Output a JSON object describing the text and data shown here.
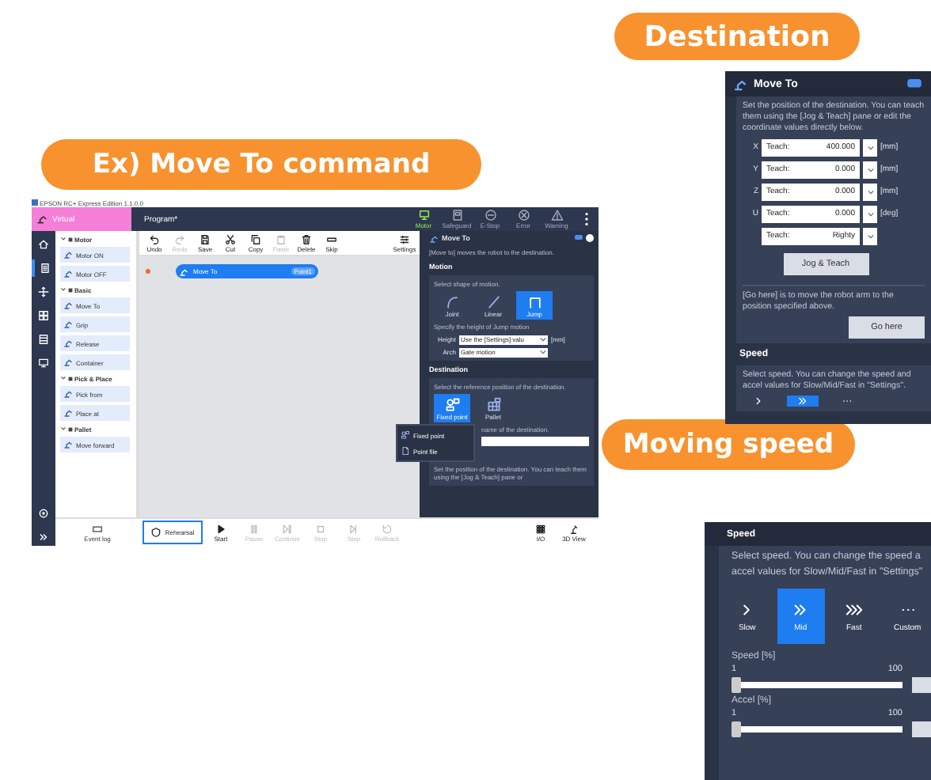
{
  "main_screenshot": {
    "callout": "Ex) Move To command",
    "window_title": "EPSON RC+ Express Edition 1.1.0.0",
    "mode_tab": "Virtual",
    "document_title": "Program*",
    "status_items": [
      {
        "label": "Motor",
        "kind": "motor",
        "on": true
      },
      {
        "label": "Safeguard",
        "kind": "safeguard",
        "on": false
      },
      {
        "label": "E-Stop",
        "kind": "estop",
        "on": false
      },
      {
        "label": "Error",
        "kind": "error",
        "on": false
      },
      {
        "label": "Warning",
        "kind": "warning",
        "on": false
      }
    ],
    "rail_items": [
      {
        "kind": "home",
        "selected": false
      },
      {
        "kind": "program",
        "selected": true
      },
      {
        "kind": "move",
        "selected": false
      },
      {
        "kind": "grid",
        "selected": false
      },
      {
        "kind": "table",
        "selected": false
      },
      {
        "kind": "monitor",
        "selected": false
      }
    ],
    "palette": [
      {
        "label": "Motor",
        "expanded": true,
        "items": [
          {
            "label": "Motor ON"
          },
          {
            "label": "Motor OFF"
          }
        ]
      },
      {
        "label": "Basic",
        "expanded": true,
        "items": [
          {
            "label": "Move To"
          },
          {
            "label": "Grip"
          },
          {
            "label": "Release"
          },
          {
            "label": "Container"
          }
        ]
      },
      {
        "label": "Pick & Place",
        "expanded": true,
        "items": [
          {
            "label": "Pick from"
          },
          {
            "label": "Place at"
          }
        ]
      },
      {
        "label": "Pallet",
        "expanded": true,
        "items": [
          {
            "label": "Move forward"
          }
        ]
      }
    ],
    "event_log": "Event log",
    "toolbar": [
      {
        "label": "Undo",
        "kind": "undo",
        "disabled": false
      },
      {
        "label": "Redo",
        "kind": "redo",
        "disabled": true
      },
      {
        "label": "Save",
        "kind": "save",
        "disabled": false
      },
      {
        "label": "Cut",
        "kind": "cut",
        "disabled": false
      },
      {
        "label": "Copy",
        "kind": "copy",
        "disabled": false
      },
      {
        "label": "Paste",
        "kind": "paste",
        "disabled": true
      },
      {
        "label": "Delete",
        "kind": "delete",
        "disabled": false
      },
      {
        "label": "Skip",
        "kind": "skip",
        "disabled": false
      }
    ],
    "settings_button": "Settings",
    "flow_node": {
      "label": "Move To",
      "badge": "Point1",
      "selected": true
    },
    "properties": {
      "title": "Move To",
      "description": "[Move to] moves the robot to the destination.",
      "motion": {
        "heading": "Motion",
        "prompt": "Select shape of motion.",
        "options": [
          {
            "label": "Joint",
            "kind": "joint",
            "selected": false
          },
          {
            "label": "Linear",
            "kind": "linear",
            "selected": false
          },
          {
            "label": "Jump",
            "kind": "jump",
            "selected": true
          }
        ],
        "height_prompt": "Specify the height of Jump motion",
        "height_label": "Height",
        "height_value": "Use the [Settings] valu",
        "height_unit": "[mm]",
        "arch_label": "Arch",
        "arch_value": "Gate motion"
      },
      "destination": {
        "heading": "Destination",
        "prompt": "Select the reference position of the destination.",
        "options": [
          {
            "label": "Fixed point",
            "kind": "fixed",
            "selected": true
          },
          {
            "label": "Pallet",
            "kind": "pallet",
            "selected": false
          }
        ],
        "menu": [
          {
            "label": "Fixed point",
            "kind": "fixed"
          },
          {
            "label": "Point file",
            "kind": "file"
          }
        ],
        "name_prompt": "name of the destination.",
        "position_prompt": "Set the position of the destination. You can teach them using the [Jog & Teach] pane or"
      }
    },
    "run_controls": [
      {
        "label": "Rehearsal",
        "kind": "rehearsal",
        "disabled": false,
        "selected": true
      },
      {
        "label": "Start",
        "kind": "start",
        "disabled": false,
        "selected": false
      },
      {
        "label": "Pause",
        "kind": "pause",
        "disabled": true,
        "selected": false
      },
      {
        "label": "Continue",
        "kind": "continue",
        "disabled": true,
        "selected": false
      },
      {
        "label": "Stop",
        "kind": "stop",
        "disabled": true,
        "selected": false
      },
      {
        "label": "Step",
        "kind": "step",
        "disabled": true,
        "selected": false
      },
      {
        "label": "Rollback",
        "kind": "rollback",
        "disabled": true,
        "selected": false
      }
    ],
    "view_buttons": [
      {
        "label": "I/O",
        "kind": "io"
      },
      {
        "label": "3D View",
        "kind": "view3d"
      }
    ]
  },
  "destination_panel": {
    "callout": "Destination",
    "title": "Move To",
    "description": "Set the position of the destination. You can teach them using the [Jog & Teach] pane or edit the coordinate values directly below.",
    "rows": [
      {
        "axis": "X",
        "mode": "Teach:",
        "value": "400.000",
        "unit": "[mm]"
      },
      {
        "axis": "Y",
        "mode": "Teach:",
        "value": "0.000",
        "unit": "[mm]"
      },
      {
        "axis": "Z",
        "mode": "Teach:",
        "value": "0.000",
        "unit": "[mm]"
      },
      {
        "axis": "U",
        "mode": "Teach:",
        "value": "0.000",
        "unit": "[deg]"
      },
      {
        "mode": "Teach:",
        "value": "Righty"
      }
    ],
    "jog_button": "Jog & Teach",
    "go_here_text": "[Go here] is to move the robot arm to the position specified above.",
    "go_here_button": "Go here",
    "speed_heading": "Speed",
    "speed_text": "Select speed. You can change the speed and accel values for Slow/Mid/Fast in \"Settings\".",
    "speed_options": [
      {
        "kind": "slow",
        "selected": false
      },
      {
        "kind": "mid",
        "selected": true
      },
      {
        "kind": "custom",
        "selected": false
      }
    ]
  },
  "speed_panel": {
    "callout": "Moving speed",
    "heading": "Speed",
    "text_lines": [
      "Select speed. You can change the speed a",
      "accel values for Slow/Mid/Fast in \"Settings\""
    ],
    "options": [
      {
        "label": "Slow",
        "kind": "slow",
        "selected": false
      },
      {
        "label": "Mid",
        "kind": "mid",
        "selected": true
      },
      {
        "label": "Fast",
        "kind": "fast",
        "selected": false
      },
      {
        "label": "Custom",
        "kind": "custom",
        "selected": false
      }
    ],
    "sliders": [
      {
        "label": "Speed [%]",
        "min": "1",
        "max": "100",
        "level": 0
      },
      {
        "label": "Accel [%]",
        "min": "1",
        "max": "100",
        "level": 0
      }
    ]
  }
}
